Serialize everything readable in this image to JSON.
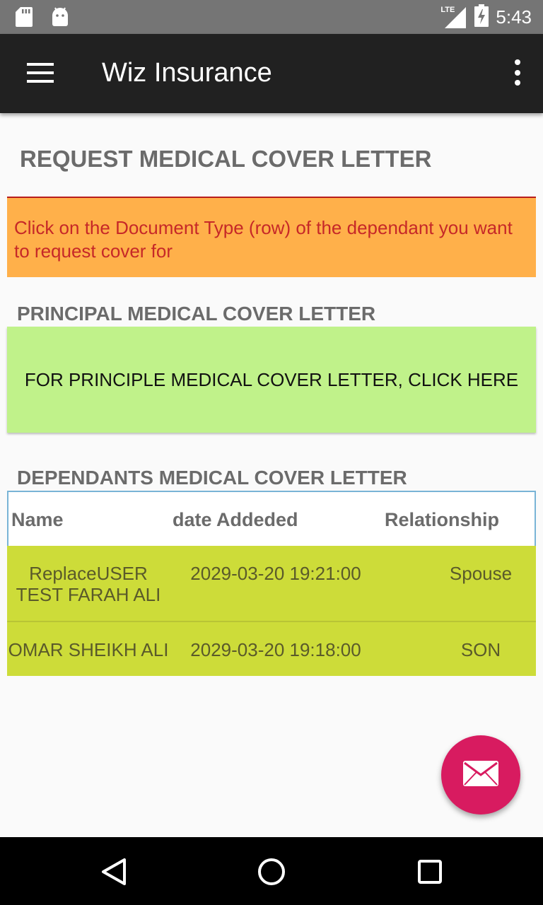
{
  "status_bar": {
    "time": "5:43",
    "network_label": "LTE",
    "icons": [
      "sd-card-icon",
      "android-icon",
      "lte-signal-icon",
      "battery-charging-icon"
    ]
  },
  "app_bar": {
    "title": "Wiz Insurance",
    "icons": [
      "menu-icon",
      "overflow-menu-icon"
    ]
  },
  "page": {
    "heading": "REQUEST MEDICAL COVER LETTER",
    "notice": "Click on the Document Type (row) of the dependant you want to request cover for"
  },
  "principal": {
    "heading": "PRINCIPAL MEDICAL COVER LETTER",
    "button_label": "FOR PRINCIPLE MEDICAL COVER LETTER, CLICK HERE"
  },
  "dependants": {
    "heading": "DEPENDANTS MEDICAL COVER LETTER",
    "columns": [
      "Name",
      "date Addeded",
      "Relationship"
    ],
    "rows": [
      {
        "name": "ReplaceUSER TEST FARAH ALI",
        "date_added": "2029-03-20 19:21:00",
        "relationship": "Spouse"
      },
      {
        "name": "OMAR SHEIKH ALI",
        "date_added": "2029-03-20 19:18:00",
        "relationship": "SON"
      }
    ]
  },
  "fab": {
    "icon": "email-icon"
  },
  "nav_bar": {
    "icons": [
      "back-icon",
      "home-icon",
      "recents-icon"
    ]
  },
  "colors": {
    "status_bar": "#757575",
    "app_bar": "#212121",
    "notice_bg": "#ffb04a",
    "notice_text": "#c62828",
    "principal_bg": "#c0f28a",
    "row_bg": "#cddc39",
    "fab": "#d81b60"
  }
}
